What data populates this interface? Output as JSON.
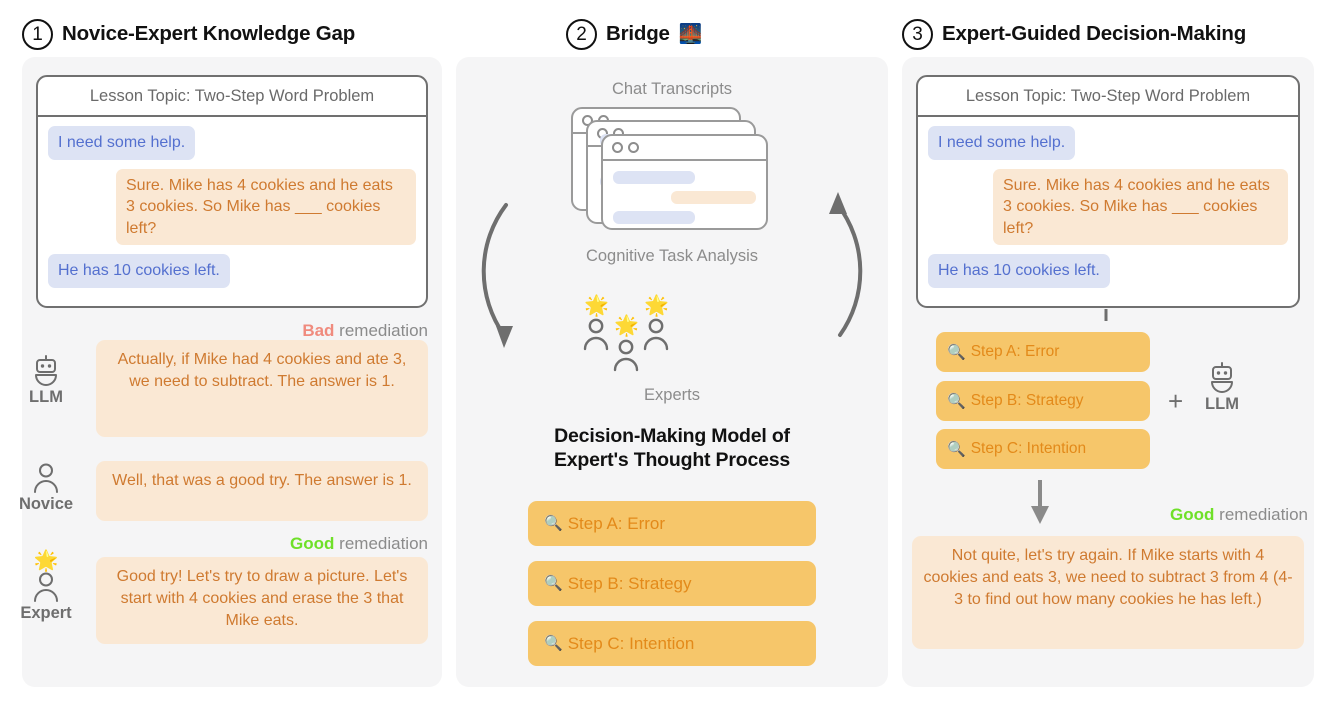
{
  "columns": [
    {
      "number": "1",
      "title": "Novice-Expert Knowledge Gap"
    },
    {
      "number": "2",
      "title": "Bridge",
      "emoji": "🌉"
    },
    {
      "number": "3",
      "title": "Expert-Guided Decision-Making"
    }
  ],
  "chat": {
    "title": "Lesson Topic: Two-Step Word Problem",
    "messages": [
      {
        "role": "user",
        "text": "I need some help."
      },
      {
        "role": "ai",
        "text": "Sure. Mike has 4 cookies and he eats 3 cookies. So Mike has ___ cookies left?"
      },
      {
        "role": "user",
        "text": "He has 10 cookies left."
      }
    ]
  },
  "panel1": {
    "bad_label_strong": "Bad",
    "bad_label_rest": " remediation",
    "good_label_strong": "Good",
    "good_label_rest": " remediation",
    "rows": [
      {
        "avatar": "llm",
        "avatar_label": "LLM",
        "icon": "robot-icon",
        "star": "",
        "text": "Actually, if Mike had 4 cookies and ate 3, we need to subtract. The answer is 1."
      },
      {
        "avatar": "novice",
        "avatar_label": "Novice",
        "icon": "person-icon",
        "star": "",
        "text": "Well, that was a good try. The answer is 1."
      },
      {
        "avatar": "expert",
        "avatar_label": "Expert",
        "icon": "person-icon",
        "star": "🌟",
        "text": "Good try! Let's try to draw a picture. Let's start with 4 cookies and erase the 3 that Mike eats."
      }
    ]
  },
  "panel2": {
    "transcripts_caption": "Chat Transcripts",
    "cycle_caption": "Cognitive Task Analysis",
    "experts_caption": "Experts",
    "experts_star": "🌟",
    "model_title_line1": "Decision-Making Model of",
    "model_title_line2": "Expert's Thought Process",
    "steps": [
      {
        "icon": "🔍",
        "label": "Step A: Error"
      },
      {
        "icon": "🔍",
        "label": "Step B: Strategy"
      },
      {
        "icon": "🔍",
        "label": "Step C: Intention"
      }
    ]
  },
  "panel3": {
    "steps": [
      {
        "icon": "🔍",
        "label": "Step A: Error"
      },
      {
        "icon": "🔍",
        "label": "Step B: Strategy"
      },
      {
        "icon": "🔍",
        "label": "Step C: Intention"
      }
    ],
    "plus": "+",
    "llm_label": "LLM",
    "good_label_strong": "Good",
    "good_label_rest": " remediation",
    "output_text": "Not quite, let's try again. If Mike starts with 4 cookies and eats 3, we need to subtract 3 from 4 (4-3 to find out how many cookies he has left.)"
  },
  "colors": {
    "panel_bg": "#f5f5f6",
    "user_bubble": "#dde3f4",
    "user_text": "#5470cf",
    "ai_bubble": "#fae8d4",
    "ai_text": "#cf7a30",
    "chip_bg": "#f6c66a",
    "chip_text": "#e38a1a",
    "bad": "#f08b7e",
    "good": "#6fe029",
    "muted": "#8b8b8b",
    "border": "#707070"
  }
}
